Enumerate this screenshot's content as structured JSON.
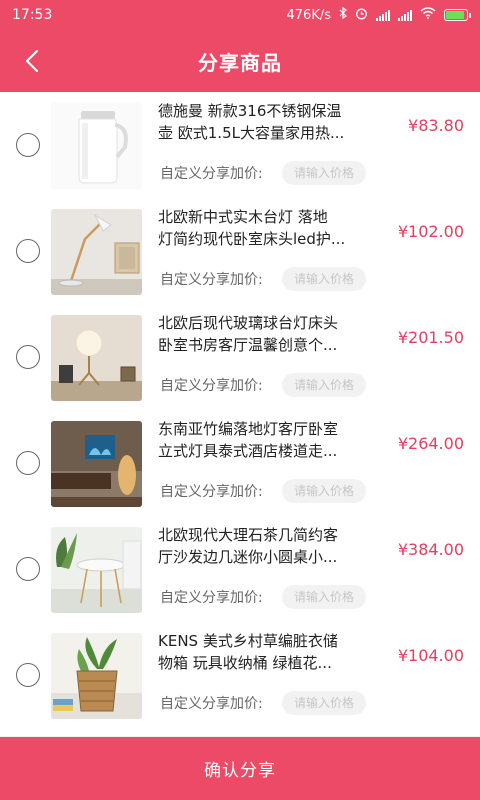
{
  "status_bar": {
    "time": "17:53",
    "network_speed": "476K/s",
    "battery_color": "#6adf5a"
  },
  "header": {
    "title": "分享商品",
    "back_icon": "chevron-left-icon"
  },
  "items": [
    {
      "title_line1": "德施曼 新款316不锈钢保温",
      "title_line2": "壶 欧式1.5L大容量家用热...",
      "price": "¥83.80",
      "add_label": "自定义分享加价:",
      "input_placeholder": "请输入价格",
      "input_value": ""
    },
    {
      "title_line1": "北欧新中式实木台灯 落地",
      "title_line2": "灯简约现代卧室床头led护...",
      "price": "¥102.00",
      "add_label": "自定义分享加价:",
      "input_placeholder": "请输入价格",
      "input_value": ""
    },
    {
      "title_line1": "北欧后现代玻璃球台灯床头",
      "title_line2": "卧室书房客厅温馨创意个...",
      "price": "¥201.50",
      "add_label": "自定义分享加价:",
      "input_placeholder": "请输入价格",
      "input_value": ""
    },
    {
      "title_line1": "东南亚竹编落地灯客厅卧室",
      "title_line2": "立式灯具泰式酒店楼道走...",
      "price": "¥264.00",
      "add_label": "自定义分享加价:",
      "input_placeholder": "请输入价格",
      "input_value": ""
    },
    {
      "title_line1": "北欧现代大理石茶几简约客",
      "title_line2": "厅沙发边几迷你小圆桌小...",
      "price": "¥384.00",
      "add_label": "自定义分享加价:",
      "input_placeholder": "请输入价格",
      "input_value": ""
    },
    {
      "title_line1": "KENS 美式乡村草编脏衣储",
      "title_line2": "物箱 玩具收纳桶 绿植花...",
      "price": "¥104.00",
      "add_label": "自定义分享加价:",
      "input_placeholder": "请输入价格",
      "input_value": ""
    }
  ],
  "footer": {
    "confirm_label": "确认分享"
  },
  "colors": {
    "accent": "#ec4a67",
    "price": "#e63e62"
  }
}
